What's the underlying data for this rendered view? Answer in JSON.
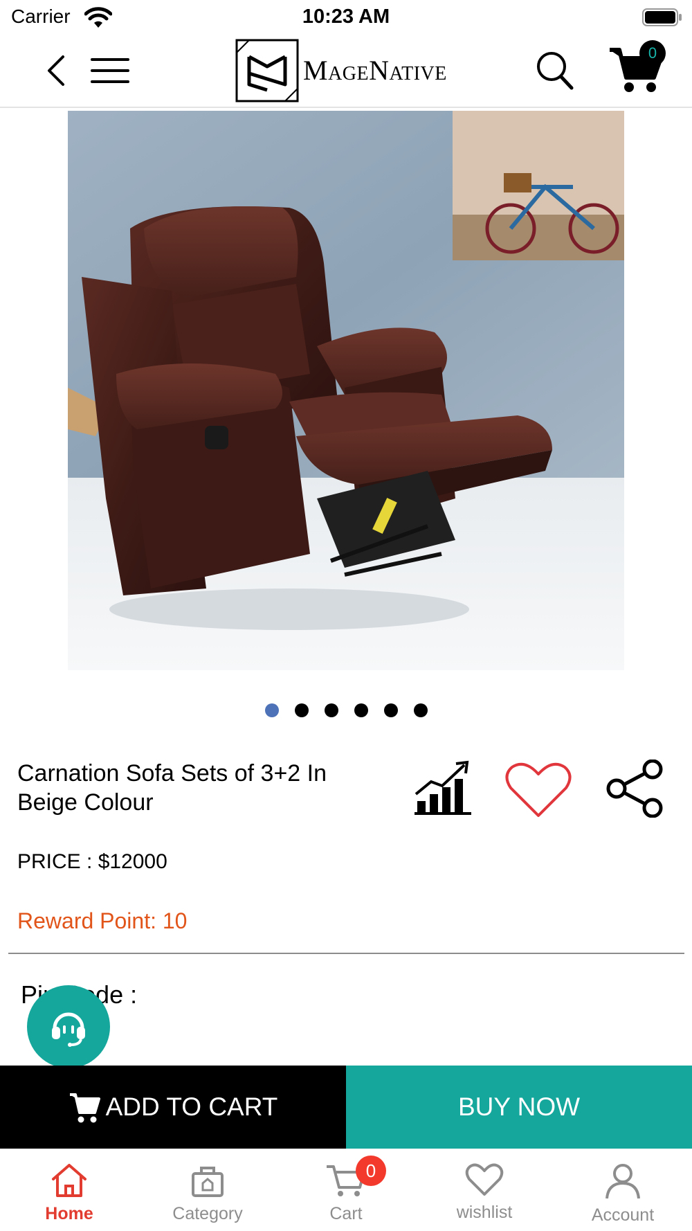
{
  "status_bar": {
    "carrier": "Carrier",
    "time": "10:23 AM"
  },
  "header": {
    "logo_text": "MageNative",
    "cart_count": "0",
    "icons": [
      "back-icon",
      "menu-icon",
      "search-icon",
      "cart-icon"
    ]
  },
  "carousel": {
    "total_images": 6,
    "active_index": 0
  },
  "product": {
    "name": "Carnation Sofa Sets of 3+2 In Beige Colour",
    "price": "PRICE : $12000",
    "reward": "Reward Point: 10",
    "pincode_label": "Pin Code :"
  },
  "actions": {
    "add_to_cart": "ADD TO CART",
    "buy_now": "BUY NOW"
  },
  "tabbar": {
    "items": [
      {
        "label": "Home",
        "icon": "home-icon",
        "active": true
      },
      {
        "label": "Category",
        "icon": "category-icon",
        "active": false
      },
      {
        "label": "Cart",
        "icon": "cart-icon",
        "active": false,
        "badge": "0"
      },
      {
        "label": "wishlist",
        "icon": "heart-icon",
        "active": false
      },
      {
        "label": "Account",
        "icon": "account-icon",
        "active": false
      }
    ]
  },
  "colors": {
    "accent": "#16a79c",
    "reward": "#e2551a",
    "active_tab": "#e23b2f",
    "active_dot": "#4e72b8",
    "wishlist": "#e0363c"
  }
}
